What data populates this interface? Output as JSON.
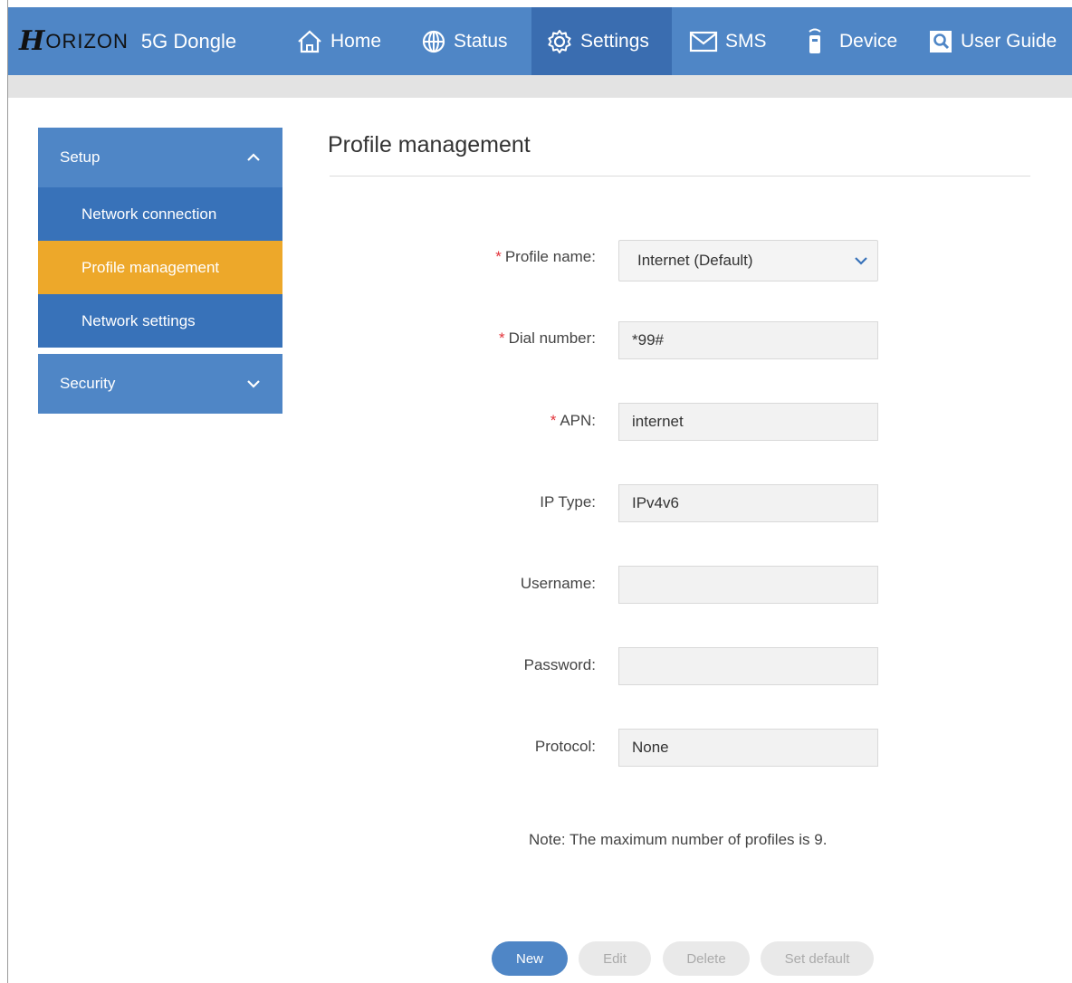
{
  "brand": {
    "logo": "H",
    "name": "ORIZON",
    "model": "5G Dongle"
  },
  "nav": [
    {
      "label": "Home",
      "icon": "home-icon"
    },
    {
      "label": "Status",
      "icon": "globe-icon"
    },
    {
      "label": "Settings",
      "icon": "gear-icon",
      "active": true
    },
    {
      "label": "SMS",
      "icon": "envelope-icon"
    },
    {
      "label": "Device",
      "icon": "device-icon"
    },
    {
      "label": "User Guide",
      "icon": "search-icon"
    }
  ],
  "sidebar": {
    "groups": [
      {
        "label": "Setup",
        "expanded": true,
        "items": [
          {
            "label": "Network connection"
          },
          {
            "label": "Profile management",
            "active": true
          },
          {
            "label": "Network settings"
          }
        ]
      },
      {
        "label": "Security",
        "expanded": false
      }
    ]
  },
  "page": {
    "title": "Profile management"
  },
  "form": {
    "profile_name": {
      "label": "Profile name:",
      "value": "Internet (Default)",
      "required": true
    },
    "dial_number": {
      "label": "Dial number:",
      "value": "*99#",
      "required": true
    },
    "apn": {
      "label": "APN:",
      "value": "internet",
      "required": true
    },
    "ip_type": {
      "label": "IP Type:",
      "value": "IPv4v6"
    },
    "username": {
      "label": "Username:",
      "value": ""
    },
    "password": {
      "label": "Password:",
      "value": ""
    },
    "protocol": {
      "label": "Protocol:",
      "value": "None"
    }
  },
  "required_mark": "*",
  "note": "Note: The maximum number of profiles is 9.",
  "buttons": {
    "new": "New",
    "edit": "Edit",
    "delete": "Delete",
    "set_default": "Set default"
  },
  "colors": {
    "primary": "#4f86c6",
    "sidebar_item": "#3872b9",
    "active": "#eda82a",
    "required": "#e2333a"
  }
}
